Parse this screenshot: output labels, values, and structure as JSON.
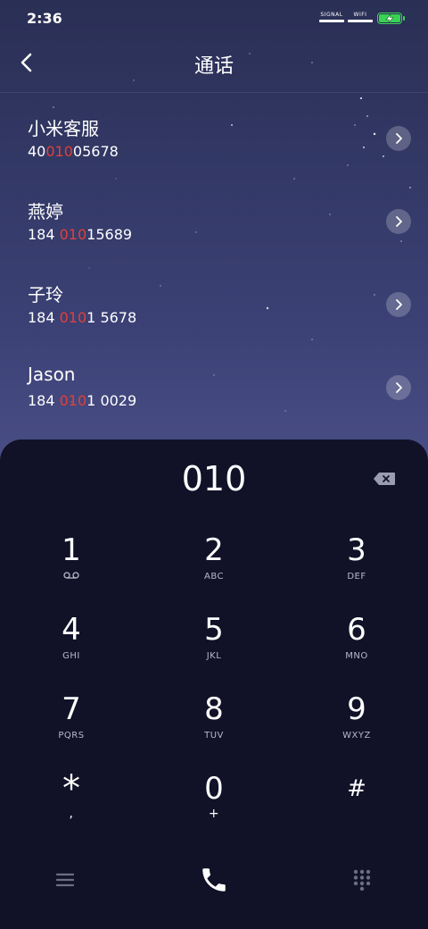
{
  "status_bar": {
    "time": "2:36",
    "signal_label": "SIGNAL",
    "wifi_label": "WIFI"
  },
  "header": {
    "title": "通话"
  },
  "contacts": [
    {
      "name": "小米客服",
      "number_pre": "40",
      "number_hl": "010",
      "number_post": "05678"
    },
    {
      "name": "燕婷",
      "number_pre": "184 ",
      "number_hl": "010",
      "number_post": "15689"
    },
    {
      "name": "子玲",
      "number_pre": "184 ",
      "number_hl": "010",
      "number_post": "1 5678"
    },
    {
      "name": "Jason",
      "number_pre": "184 ",
      "number_hl": "010",
      "number_post": "1 0029"
    }
  ],
  "dialpad": {
    "input_value": "010",
    "keys": [
      {
        "digit": "1",
        "sub": ""
      },
      {
        "digit": "2",
        "sub": "ABC"
      },
      {
        "digit": "3",
        "sub": "DEF"
      },
      {
        "digit": "4",
        "sub": "GHI"
      },
      {
        "digit": "5",
        "sub": "JKL"
      },
      {
        "digit": "6",
        "sub": "MNO"
      },
      {
        "digit": "7",
        "sub": "PQRS"
      },
      {
        "digit": "8",
        "sub": "TUV"
      },
      {
        "digit": "9",
        "sub": "WXYZ"
      },
      {
        "digit": "*",
        "sub": ","
      },
      {
        "digit": "0",
        "sub": "+"
      },
      {
        "digit": "#",
        "sub": ""
      }
    ]
  },
  "colors": {
    "highlight": "#e0403a",
    "battery": "#39d353",
    "dialpad_bg": "#111228"
  },
  "icons": [
    "back-icon",
    "chevron-right-icon",
    "backspace-icon",
    "voicemail-icon",
    "menu-icon",
    "phone-icon",
    "keypad-icon"
  ]
}
